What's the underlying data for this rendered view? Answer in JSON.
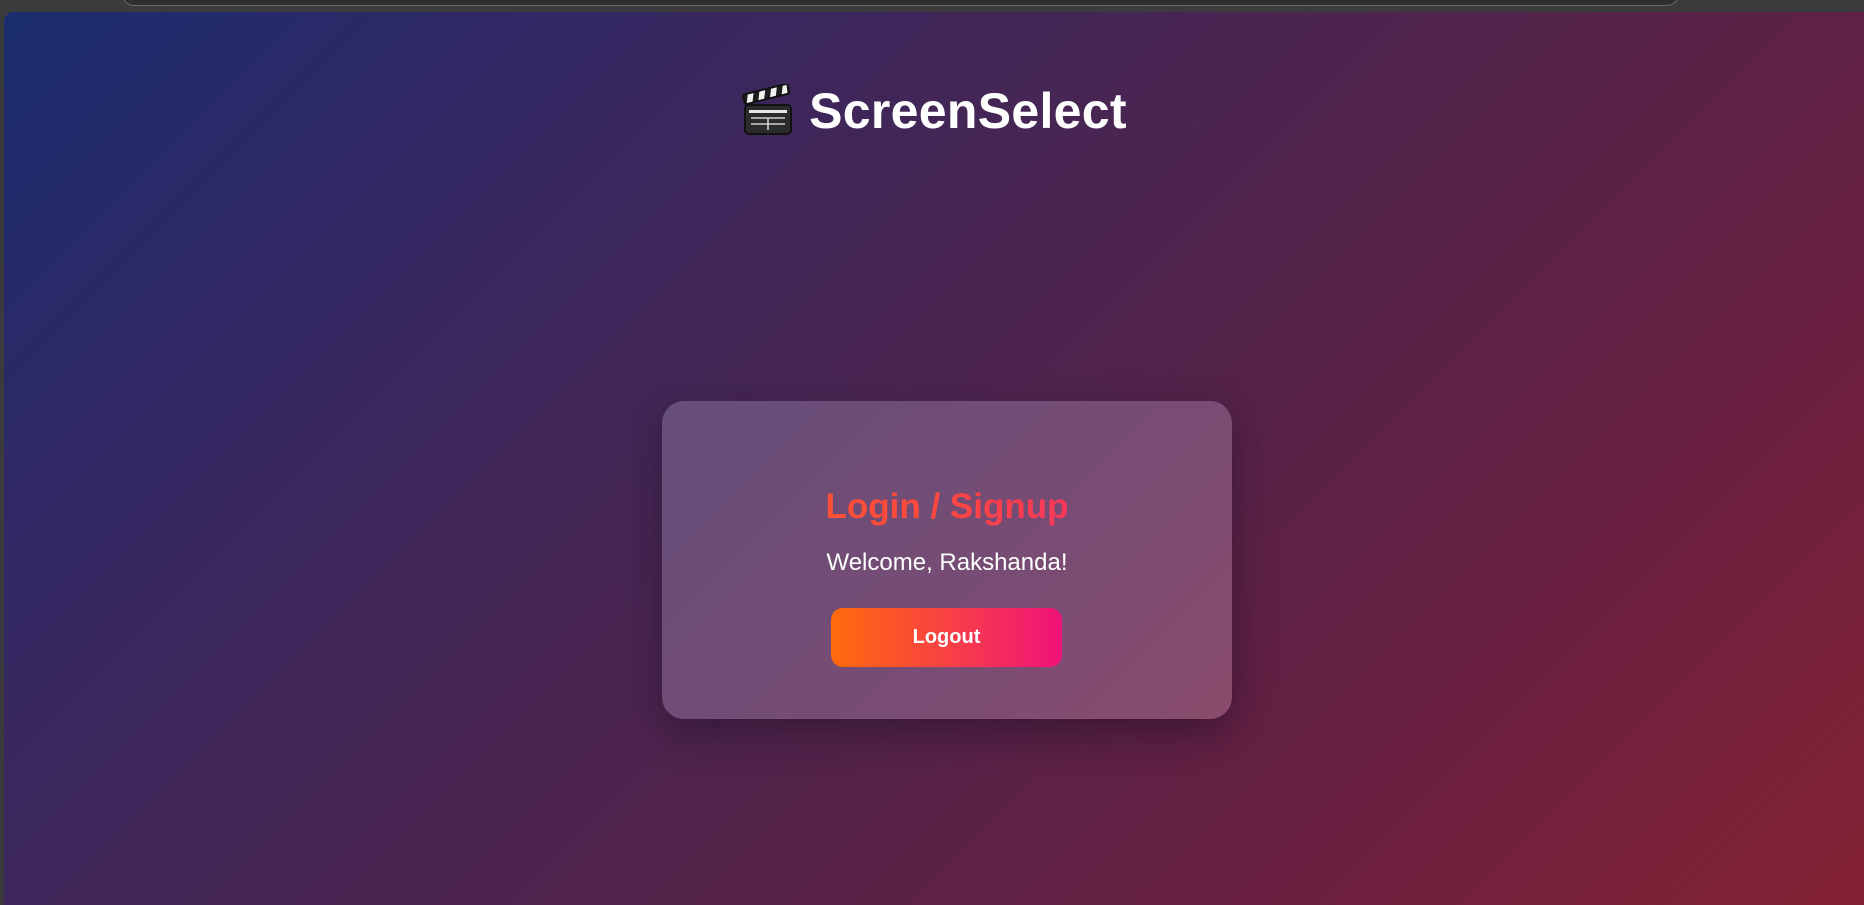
{
  "app": {
    "name": "ScreenSelect",
    "logo_icon": "clapperboard-icon"
  },
  "card": {
    "title": "Login / Signup",
    "welcome": "Welcome, Rakshanda!",
    "logout_label": "Logout"
  },
  "colors": {
    "background_start": "#1a2d6e",
    "background_end": "#842233",
    "title_gradient_start": "#ff5a2a",
    "title_gradient_end": "#f2237a",
    "button_gradient_start": "#ff6a0c",
    "button_gradient_end": "#f0127a"
  }
}
